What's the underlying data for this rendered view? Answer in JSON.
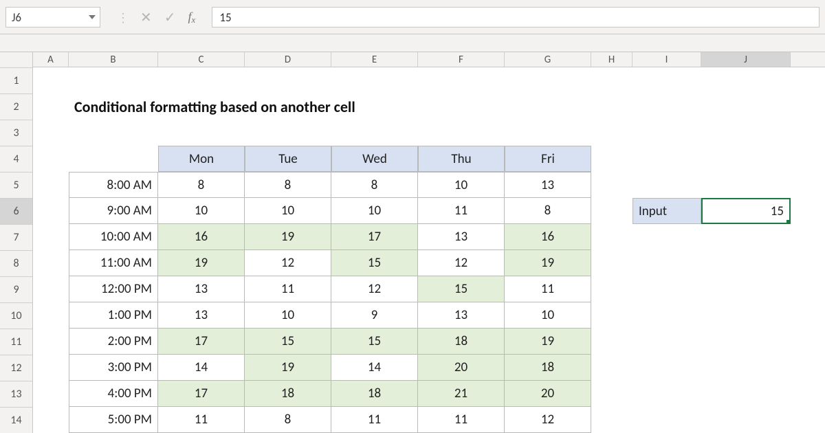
{
  "formula_bar": {
    "name_box": "J6",
    "value": "15"
  },
  "columns": [
    "A",
    "B",
    "C",
    "D",
    "E",
    "F",
    "G",
    "H",
    "I",
    "J"
  ],
  "row_numbers": [
    "1",
    "2",
    "3",
    "4",
    "5",
    "6",
    "7",
    "8",
    "9",
    "10",
    "11",
    "12",
    "13",
    "14"
  ],
  "selected_col": "J",
  "selected_row": "6",
  "title": "Conditional formatting based on another cell",
  "table": {
    "days": [
      "Mon",
      "Tue",
      "Wed",
      "Thu",
      "Fri"
    ],
    "times": [
      "8:00 AM",
      "9:00 AM",
      "10:00 AM",
      "11:00 AM",
      "12:00 PM",
      "1:00 PM",
      "2:00 PM",
      "3:00 PM",
      "4:00 PM",
      "5:00 PM"
    ]
  },
  "input": {
    "label": "Input",
    "value": "15"
  },
  "chart_data": {
    "type": "table",
    "title": "Conditional formatting based on another cell",
    "threshold": 15,
    "highlight_rule": "value >= threshold",
    "columns": [
      "Mon",
      "Tue",
      "Wed",
      "Thu",
      "Fri"
    ],
    "rows": [
      "8:00 AM",
      "9:00 AM",
      "10:00 AM",
      "11:00 AM",
      "12:00 PM",
      "1:00 PM",
      "2:00 PM",
      "3:00 PM",
      "4:00 PM",
      "5:00 PM"
    ],
    "values": [
      [
        8,
        8,
        8,
        10,
        13
      ],
      [
        10,
        10,
        10,
        11,
        8
      ],
      [
        16,
        19,
        17,
        13,
        16
      ],
      [
        19,
        12,
        15,
        12,
        19
      ],
      [
        13,
        11,
        12,
        15,
        11
      ],
      [
        13,
        10,
        9,
        13,
        10
      ],
      [
        17,
        15,
        15,
        18,
        19
      ],
      [
        14,
        19,
        14,
        20,
        18
      ],
      [
        17,
        18,
        18,
        21,
        20
      ],
      [
        11,
        8,
        11,
        11,
        12
      ]
    ]
  }
}
